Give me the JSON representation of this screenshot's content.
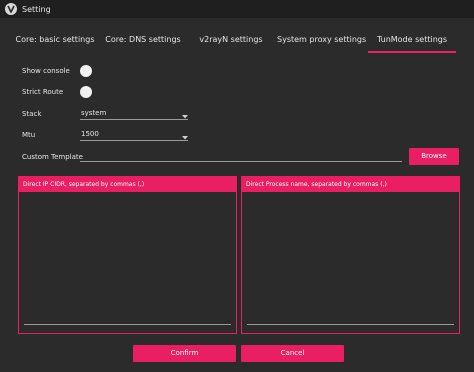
{
  "window": {
    "title": "Setting",
    "icon": "v2rayn-logo-icon"
  },
  "tabs": [
    {
      "label": "Core: basic settings",
      "active": false
    },
    {
      "label": "Core: DNS settings",
      "active": false
    },
    {
      "label": "v2rayN settings",
      "active": false
    },
    {
      "label": "System proxy settings",
      "active": false
    },
    {
      "label": "TunMode settings",
      "active": true
    }
  ],
  "form": {
    "show_console": {
      "label": "Show console",
      "value": false
    },
    "strict_route": {
      "label": "Strict Route",
      "value": false
    },
    "stack": {
      "label": "Stack",
      "value": "system"
    },
    "mtu": {
      "label": "Mtu",
      "value": "1500"
    },
    "custom_template": {
      "label": "Custom Template",
      "value": "",
      "browse_label": "Browse"
    }
  },
  "panels": {
    "direct_ip": {
      "title": "Direct IP CIDR, separated by commas (,)",
      "value": ""
    },
    "direct_process": {
      "title": "Direct Process name, separated by commas (,)",
      "value": ""
    }
  },
  "footer": {
    "confirm_label": "Confirm",
    "cancel_label": "Cancel"
  },
  "colors": {
    "accent": "#e91e63",
    "background": "#2b2b2b",
    "titlebar": "#1f1f1f"
  }
}
